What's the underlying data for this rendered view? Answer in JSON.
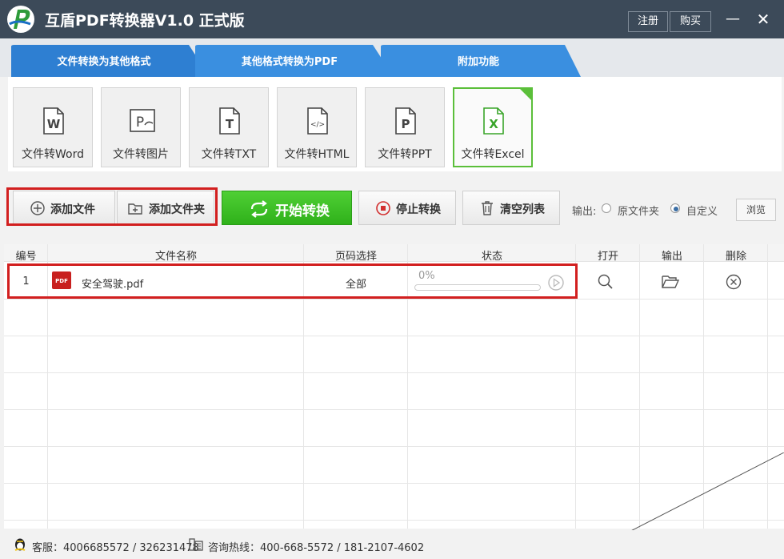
{
  "window": {
    "title": "互盾PDF转换器V1.0 正式版",
    "register_label": "注册",
    "buy_label": "购买",
    "minimize_glyph": "—",
    "close_glyph": "✕"
  },
  "tabs": [
    {
      "label": "文件转换为其他格式",
      "active": true
    },
    {
      "label": "其他格式转换为PDF",
      "active": false
    },
    {
      "label": "附加功能",
      "active": false
    }
  ],
  "convert_targets": [
    {
      "label": "文件转Word",
      "icon": "word-file-icon",
      "glyph": "W"
    },
    {
      "label": "文件转图片",
      "icon": "image-file-icon",
      "glyph": "P"
    },
    {
      "label": "文件转TXT",
      "icon": "txt-file-icon",
      "glyph": "T"
    },
    {
      "label": "文件转HTML",
      "icon": "html-file-icon",
      "glyph": "</>"
    },
    {
      "label": "文件转PPT",
      "icon": "ppt-file-icon",
      "glyph": "P"
    },
    {
      "label": "文件转Excel",
      "icon": "excel-file-icon",
      "glyph": "X",
      "selected": true
    }
  ],
  "actions": {
    "add_file": "添加文件",
    "add_folder": "添加文件夹",
    "start": "开始转换",
    "stop": "停止转换",
    "clear": "清空列表"
  },
  "output": {
    "label": "输出:",
    "option_source": "原文件夹",
    "option_custom": "自定义",
    "selected": "自定义",
    "browse": "浏览"
  },
  "table": {
    "headers": [
      "编号",
      "文件名称",
      "页码选择",
      "状态",
      "打开",
      "输出",
      "删除"
    ],
    "rows": [
      {
        "index": "1",
        "file_badge": "PDF",
        "file_name": "安全驾驶.pdf",
        "pages": "全部",
        "progress_text": "0%",
        "progress": 0
      }
    ]
  },
  "status_bar": {
    "service": "客服：4006685572 / 326231478",
    "hotline": "咨询热线：400-668-5572 / 181-2107-4602"
  },
  "colors": {
    "titlebar": "#3c4a59",
    "tab_active": "#2e7fd2",
    "tab_inactive": "#3a8fe0",
    "start_green": "#3bbf22",
    "highlight_red": "#d21f1f"
  }
}
